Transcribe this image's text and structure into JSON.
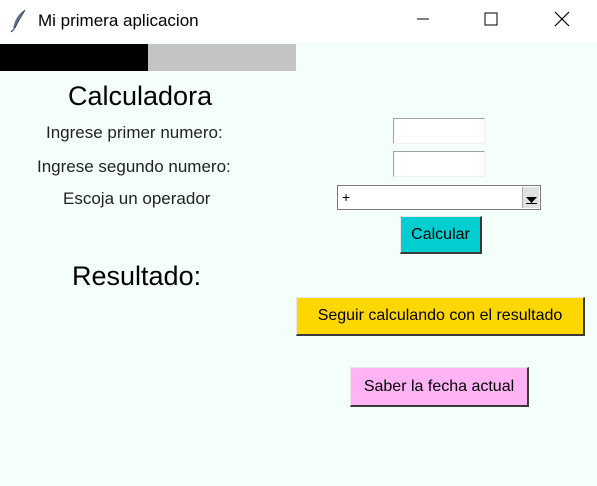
{
  "window": {
    "title": "Mi primera aplicacion",
    "icons": {
      "app": "feather-icon",
      "minimize": "minimize-icon",
      "maximize": "maximize-icon",
      "close": "close-icon"
    }
  },
  "progress": {
    "fraction": 0.5,
    "fill_color": "#000000",
    "track_color": "#c4c4c4"
  },
  "form": {
    "heading": "Calculadora",
    "first_label": "Ingrese primer numero:",
    "first_value": "",
    "second_label": "Ingrese segundo numero:",
    "second_value": "",
    "operator_label": "Escoja un operador",
    "operator_selected": "+"
  },
  "buttons": {
    "calculate": "Calcular",
    "continue": "Seguir calculando con el resultado",
    "date": "Saber la fecha actual"
  },
  "result": {
    "label": "Resultado:"
  },
  "colors": {
    "background": "#f5fffa",
    "calculate_button": "#00ced1",
    "continue_button": "#ffd700",
    "date_button": "#ffb3f5"
  }
}
